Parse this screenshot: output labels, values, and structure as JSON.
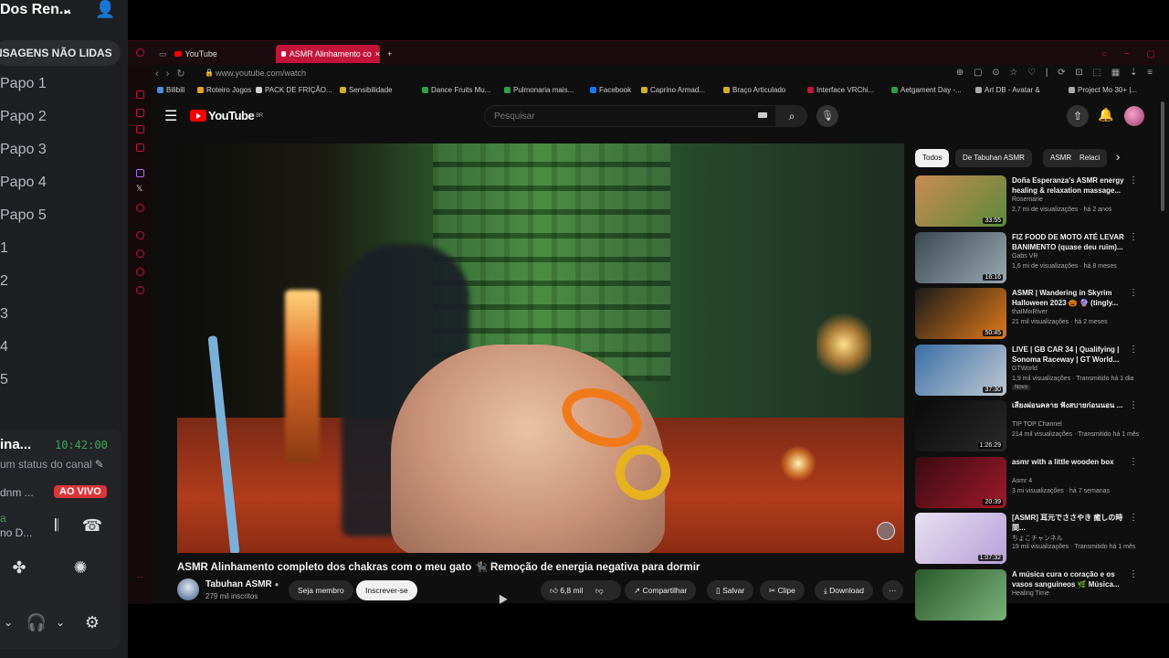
{
  "discord": {
    "server_name": "Dos Ren...",
    "unread_label": "NSAGENS NÃO LIDAS",
    "channels": [
      "Papo 1",
      "Papo 2",
      "Papo 3",
      "Papo 4",
      "Papo 5",
      "1",
      "2",
      "3",
      "4",
      "5"
    ],
    "user_name": "ina...",
    "clock": "10:42:00",
    "status_text": "um status do canal",
    "sub_user": "dnm ...",
    "live_badge": "AO VIVO",
    "voice_line1": "a",
    "voice_line2": "no D..."
  },
  "browser": {
    "tabs": [
      {
        "label": "YouTube",
        "active": false
      },
      {
        "label": "ASMR Alinhamento co",
        "active": true
      }
    ],
    "url": "www.youtube.com/watch",
    "bookmarks": [
      {
        "label": "Bilibili",
        "color": "#4a90e2"
      },
      {
        "label": "Roteiro Jogos",
        "color": "#e8a020"
      },
      {
        "label": "PACK DE FRIÇÃO...",
        "color": "#d0d0d0"
      },
      {
        "label": "Sensibilidade",
        "color": "#d4b020"
      },
      {
        "label": "Dance Fruits Mu...",
        "color": "#2ea043"
      },
      {
        "label": "Pulmonaria mais...",
        "color": "#2ea043"
      },
      {
        "label": "Facebook",
        "color": "#1877f2"
      },
      {
        "label": "Caprino Armad...",
        "color": "#d4b020"
      },
      {
        "label": "Braço Articulado",
        "color": "#d4b020"
      },
      {
        "label": "Interface VRChi...",
        "color": "#c2143a"
      },
      {
        "label": "Aetgament Day -...",
        "color": "#2ea043"
      },
      {
        "label": "Art DB - Avatar &",
        "color": "#aaaaaa"
      },
      {
        "label": "Project Mo 30+ |...",
        "color": "#aaaaaa"
      }
    ]
  },
  "youtube": {
    "logo": "YouTube",
    "logo_region": "BR",
    "search_placeholder": "Pesquisar",
    "video_title": "ASMR Alinhamento completo dos chakras com o meu gato 🐈‍⬛ Remoção de energia negativa para dormir",
    "channel_name": "Tabuhan ASMR",
    "channel_subs": "279 mil inscritos",
    "join_label": "Seja membro",
    "subscribe_label": "Inscrever-se",
    "like_count": "6,8 mil",
    "share_label": "Compartilhar",
    "save_label": "Salvar",
    "clip_label": "Clipe",
    "download_label": "Download",
    "chips": [
      "Todos",
      "De Tabuhan ASMR",
      "ASMR",
      "Relaci"
    ],
    "recommendations": [
      {
        "title": "Doña Esperanza's ASMR energy healing & relaxation massage...",
        "channel": "Rosemarie",
        "meta": "2,7 mi de visualizações · há 2 anos",
        "duration": "33:55",
        "thumb": [
          "#c98a52",
          "#5c8a3a"
        ]
      },
      {
        "title": "FIZ FOOD DE MOTO ATÉ LEVAR BANIMENTO (quase deu ruim)...",
        "channel": "Gabs VR",
        "meta": "1,6 mi de visualizações · há 8 meses",
        "duration": "16:16",
        "thumb": [
          "#3a4a52",
          "#9aa7b0"
        ]
      },
      {
        "title": "ASMR | Wandering in Skyrim Halloween 2023 🎃 🔮 (tingly...",
        "channel": "thatMixRiver",
        "meta": "21 mil visualizações · há 2 meses",
        "duration": "50:45",
        "thumb": [
          "#1a1a1a",
          "#e07a1a"
        ]
      },
      {
        "title": "LIVE | GB CAR 34 | Qualifying | Sonoma Raceway | GT World...",
        "channel": "GTWorld",
        "meta": "1,9 mil visualizações · Transmitido há 1 dia",
        "duration": "37:30",
        "badge": "Novo",
        "thumb": [
          "#3a6fa8",
          "#c0c8d0"
        ]
      },
      {
        "title": "เสียงผ่อนคลาย ฟังสบายก่อนนอน ...",
        "channel": "TIP TOP Channel",
        "meta": "214 mil visualizações · Transmitido há 1 mês",
        "duration": "1:26:29",
        "thumb": [
          "#0a0a0a",
          "#2a2a2a"
        ]
      },
      {
        "title": "asmr with a little wooden box",
        "channel": "Asmr 4",
        "meta": "3 mi visualizações · há 7 semanas",
        "duration": "20:39",
        "thumb": [
          "#3a0a12",
          "#a01a2a"
        ]
      },
      {
        "title": "[ASMR] 耳元でささやき 癒しの時間...",
        "channel": "ちょこチャンネル",
        "meta": "19 mil visualizações · Transmitido há 1 mês",
        "duration": "1:07:32",
        "thumb": [
          "#e6e0f0",
          "#b8a0d8"
        ]
      },
      {
        "title": "A música cura o coração e os vasos sanguíneos 🌿 Música...",
        "channel": "Healing Time",
        "meta": "",
        "duration": "",
        "thumb": [
          "#2a5a2a",
          "#7ab07a"
        ]
      }
    ]
  }
}
